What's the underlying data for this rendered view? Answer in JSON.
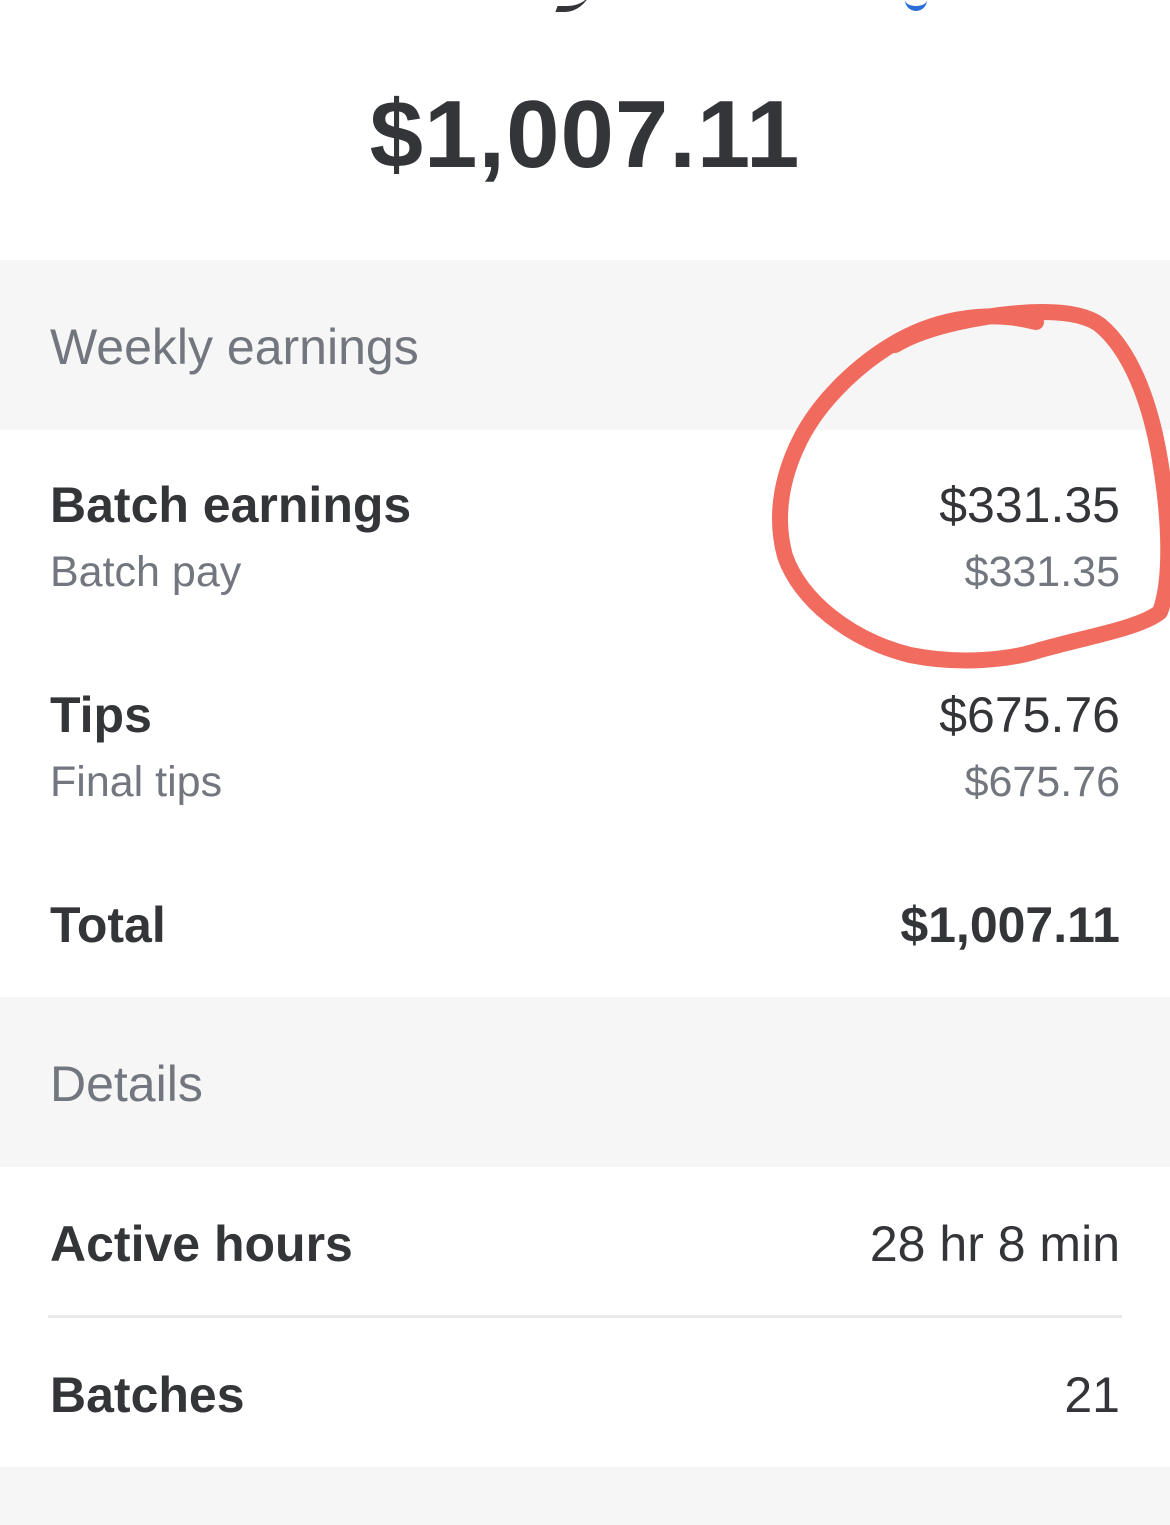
{
  "header": {
    "total_amount": "$1,007.11"
  },
  "weekly_earnings": {
    "section_title": "Weekly earnings",
    "batch_earnings": {
      "label": "Batch earnings",
      "amount": "$331.35",
      "sub_label": "Batch pay",
      "sub_amount": "$331.35"
    },
    "tips": {
      "label": "Tips",
      "amount": "$675.76",
      "sub_label": "Final tips",
      "sub_amount": "$675.76"
    },
    "total": {
      "label": "Total",
      "amount": "$1,007.11"
    }
  },
  "details": {
    "section_title": "Details",
    "active_hours": {
      "label": "Active hours",
      "value": "28 hr 8 min"
    },
    "batches": {
      "label": "Batches",
      "value": "21"
    }
  },
  "annotation": {
    "stroke_color": "#ee4a3c"
  },
  "colors": {
    "primary_text": "#343538",
    "secondary_text": "#72767e",
    "section_background": "#f6f6f6",
    "divider": "#e8e9eb"
  }
}
